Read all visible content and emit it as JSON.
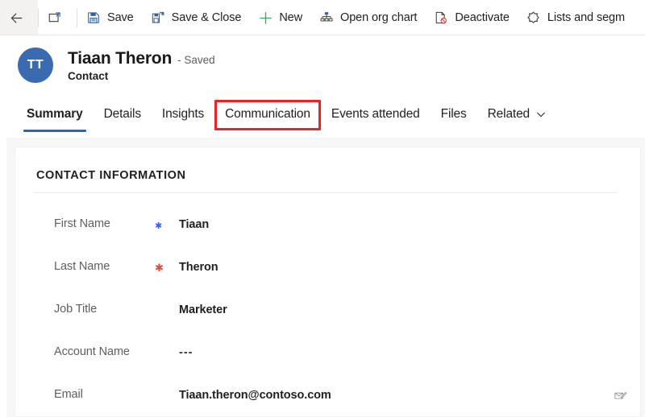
{
  "command_bar": {
    "items": [
      {
        "id": "back",
        "icon": "back-arrow-icon",
        "label": ""
      },
      {
        "id": "popout",
        "icon": "pop-out-icon",
        "label": ""
      },
      {
        "id": "save",
        "icon": "save-icon",
        "label": "Save"
      },
      {
        "id": "save-close",
        "icon": "save-and-close-icon",
        "label": "Save & Close"
      },
      {
        "id": "new",
        "icon": "plus-icon",
        "label": "New"
      },
      {
        "id": "open-org-chart",
        "icon": "org-chart-icon",
        "label": "Open org chart"
      },
      {
        "id": "deactivate",
        "icon": "deactivate-icon",
        "label": "Deactivate"
      },
      {
        "id": "lists",
        "icon": "lists-segments-icon",
        "label": "Lists and segm"
      }
    ]
  },
  "record_header": {
    "avatar_initials": "TT",
    "avatar_color": "#3a6bb0",
    "name": "Tiaan Theron",
    "state": "- Saved",
    "entity": "Contact"
  },
  "tabs": {
    "items": [
      {
        "label": "Summary",
        "active": true,
        "annotated": false,
        "chevron": false
      },
      {
        "label": "Details",
        "active": false,
        "annotated": false,
        "chevron": false
      },
      {
        "label": "Insights",
        "active": false,
        "annotated": false,
        "chevron": false
      },
      {
        "label": "Communication",
        "active": false,
        "annotated": true,
        "chevron": false
      },
      {
        "label": "Events attended",
        "active": false,
        "annotated": false,
        "chevron": false
      },
      {
        "label": "Files",
        "active": false,
        "annotated": false,
        "chevron": false
      },
      {
        "label": "Related",
        "active": false,
        "annotated": false,
        "chevron": true
      }
    ],
    "active_underline_color": "#2266c8",
    "annotation_color": "#ee2222"
  },
  "form": {
    "section_title": "CONTACT INFORMATION",
    "fields": [
      {
        "label": "First Name",
        "required": "recommended",
        "value": "Tiaan",
        "action_icon": ""
      },
      {
        "label": "Last Name",
        "required": "required",
        "value": "Theron",
        "action_icon": ""
      },
      {
        "label": "Job Title",
        "required": "none",
        "value": "Marketer",
        "action_icon": ""
      },
      {
        "label": "Account Name",
        "required": "none",
        "value": "---",
        "action_icon": ""
      },
      {
        "label": "Email",
        "required": "none",
        "value": "Tiaan.theron@contoso.com",
        "action_icon": "email-compose-icon"
      }
    ]
  }
}
